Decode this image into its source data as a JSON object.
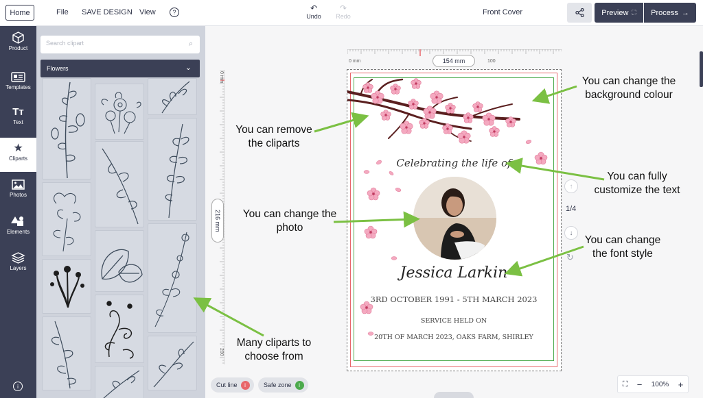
{
  "topbar": {
    "home": "Home",
    "menu": [
      "File",
      "SAVE DESIGN",
      "View"
    ],
    "help": "?",
    "undo": "Undo",
    "redo": "Redo",
    "document_title": "Front Cover",
    "preview": "Preview",
    "process": "Process"
  },
  "nav": [
    {
      "label": "Product",
      "icon": "cube-icon"
    },
    {
      "label": "Templates",
      "icon": "id-card-icon"
    },
    {
      "label": "Text",
      "icon": "text-icon"
    },
    {
      "label": "Cliparts",
      "icon": "star-icon"
    },
    {
      "label": "Photos",
      "icon": "image-icon"
    },
    {
      "label": "Elements",
      "icon": "shapes-icon"
    },
    {
      "label": "Layers",
      "icon": "layers-icon"
    }
  ],
  "panel": {
    "search_placeholder": "Search clipart",
    "category": "Flowers"
  },
  "rulers": {
    "top_left": "0 mm",
    "top_width": "154 mm",
    "top_right": "100",
    "left_top": "0 mm",
    "left_height": "216 mm",
    "left_bottom": "200"
  },
  "cover": {
    "title": "Celebrating the life of",
    "name": "Jessica Larkin",
    "dates": "3RD OCTOBER 1991 - 5TH MARCH 2023",
    "service_line1": "SERVICE HELD ON",
    "service_line2": "20TH OF MARCH 2023, OAKS FARM, SHIRLEY"
  },
  "page_counter": "1/4",
  "bottom": {
    "cut_line": "Cut line",
    "safe_zone": "Safe zone",
    "zoom": "100%",
    "cut_color": "#e8666a",
    "safe_color": "#4caa4c"
  },
  "annotations": {
    "background": "You can change the background colour",
    "remove": "You can remove the cliparts",
    "text": "You can fully customize the text",
    "photo": "You can change the photo",
    "font": "You can change the font style",
    "many": "Many cliparts to choose from"
  },
  "colors": {
    "nav_bg": "#3b4056",
    "arrow": "#7bc043",
    "blossom": "#f4a9c0"
  }
}
